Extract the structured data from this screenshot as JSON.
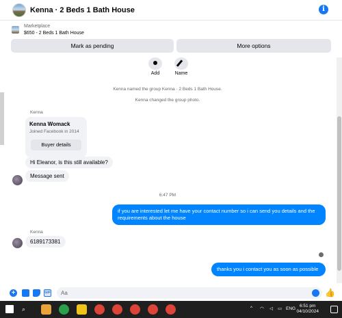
{
  "header": {
    "title": "Kenna · 2 Beds 1 Bath House",
    "info_icon": "info-icon"
  },
  "market": {
    "label": "Marketplace",
    "listing": "$650 - 2 Beds 1 Bath House",
    "pending_button": "Mark as pending",
    "more_button": "More options"
  },
  "actions": {
    "add": "Add",
    "name": "Name"
  },
  "system": {
    "named": "Kenna named the group Kenna · 2 Beds 1 Bath House.",
    "photo": "Kenna changed the group photo."
  },
  "card": {
    "sender": "Kenna",
    "name": "Kenna Womack",
    "joined": "Joined Facebook in 2014",
    "button": "Buyer details"
  },
  "messages": {
    "m1": "Hi Eleanor, is this still available?",
    "m2": "Message sent",
    "time": "6:47 PM",
    "m3": "if you are interested let me have your contact number so i can send you details and the requirements about the house",
    "sender2": "Kenna",
    "m4": "6189173381",
    "m5": "thanks you i contact you as soon as possible"
  },
  "composer": {
    "placeholder": "Aa"
  },
  "taskbar": {
    "lang": "ENG",
    "time": "6:51 pm",
    "date": "04/10/2024",
    "colors": {
      "bg": "#1f1f1f",
      "accent": "#1877f2",
      "bubble_out": "#0084ff"
    }
  }
}
